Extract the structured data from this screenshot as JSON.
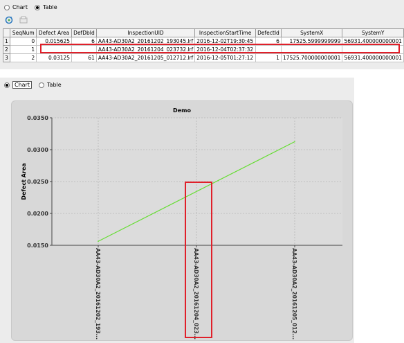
{
  "top_view": {
    "mode_options": [
      {
        "label": "Chart",
        "selected": false
      },
      {
        "label": "Table",
        "selected": true
      }
    ],
    "toolbar": [
      "refresh-icon",
      "export-icon"
    ],
    "table": {
      "columns": [
        "SeqNum",
        "Defect Area",
        "DefDbId",
        "InspectionUID",
        "InspectionStartTime",
        "DefectId",
        "SystemX",
        "SystemY"
      ],
      "rows": [
        {
          "rownum": "1",
          "cells": [
            "0",
            "0.015625",
            "6",
            "AA43-AD30A2_20161202_193045.lrf",
            "2016-12-02T19:30:45",
            "6",
            "17525.5999999999",
            "56931.400000000001"
          ]
        },
        {
          "rownum": "2",
          "cells": [
            "1",
            "",
            "",
            "AA43-AD30A2_20161204_023732.lrf",
            "2016-12-04T02:37:32",
            "",
            "",
            ""
          ]
        },
        {
          "rownum": "3",
          "cells": [
            "2",
            "0.03125",
            "61",
            "AA43-AD30A2_20161205_012712.lrf",
            "2016-12-05T01:27:12",
            "1",
            "17525.700000000001",
            "56931.400000000001"
          ]
        }
      ]
    },
    "highlight_color": "#e0202a"
  },
  "bottom_view": {
    "mode_options": [
      {
        "label": "Chart",
        "selected": true
      },
      {
        "label": "Table",
        "selected": false
      }
    ]
  },
  "chart_data": {
    "type": "line",
    "title": "Demo",
    "ylabel": "Defect Area",
    "xlabel": "",
    "categories": [
      "AA43-AD30A2_20161202_193...",
      "AA43-AD30A2_20161204_023...",
      "AA43-AD30A2_20161205_012..."
    ],
    "series": [
      {
        "values": [
          0.015625,
          null,
          0.03125
        ],
        "color": "#66dd33"
      }
    ],
    "ylim": [
      0.015,
      0.035
    ],
    "yticks": [
      "0.0150",
      "0.0200",
      "0.0250",
      "0.0300",
      "0.0350"
    ],
    "grid": true,
    "legend": false
  }
}
